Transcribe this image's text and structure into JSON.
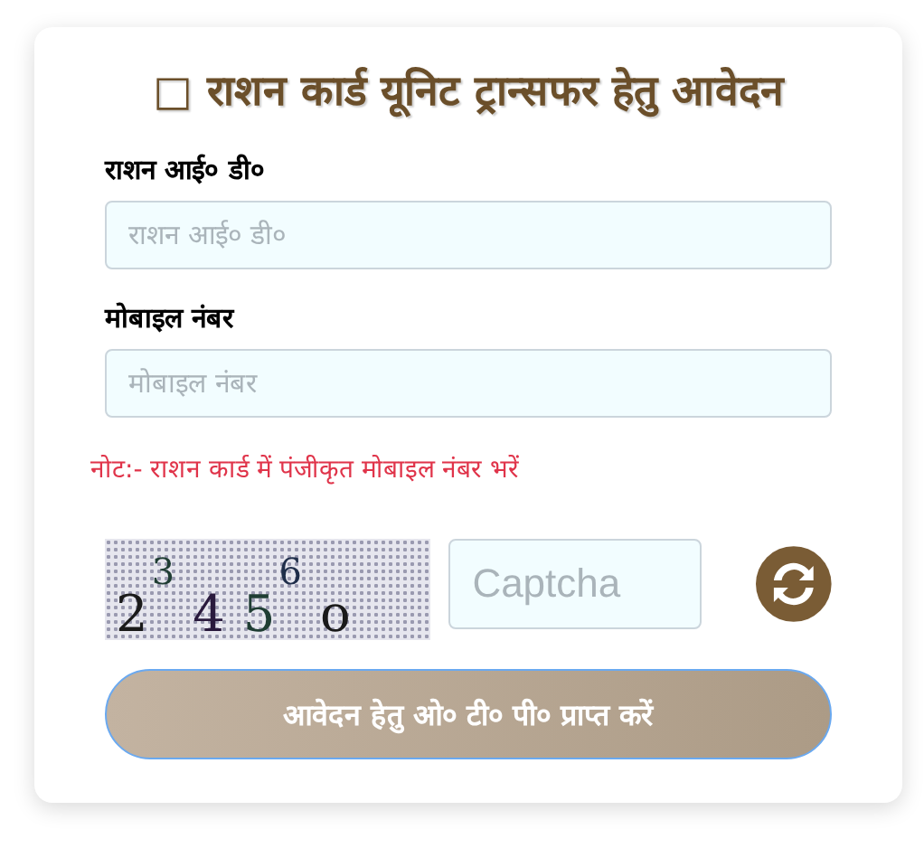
{
  "title": "□ राशन कार्ड यूनिट ट्रान्सफर हेतु आवेदन",
  "fields": [
    {
      "label": "राशन आई० डी०",
      "placeholder": "राशन आई० डी०"
    },
    {
      "label": "मोबाइल नंबर",
      "placeholder": "मोबाइल नंबर"
    }
  ],
  "note": "नोट:- राशन कार्ड में पंजीकृत मोबाइल नंबर भरें",
  "captcha": {
    "chars": [
      {
        "char": "2",
        "raised": false
      },
      {
        "char": "3",
        "raised": true
      },
      {
        "char": "4",
        "raised": false
      },
      {
        "char": "5",
        "raised": false
      },
      {
        "char": "6",
        "raised": true
      },
      {
        "char": "o",
        "raised": false
      }
    ],
    "placeholder": "Captcha"
  },
  "submit_button": "आवेदन हेतु ओ० टी० पी० प्राप्त करें"
}
